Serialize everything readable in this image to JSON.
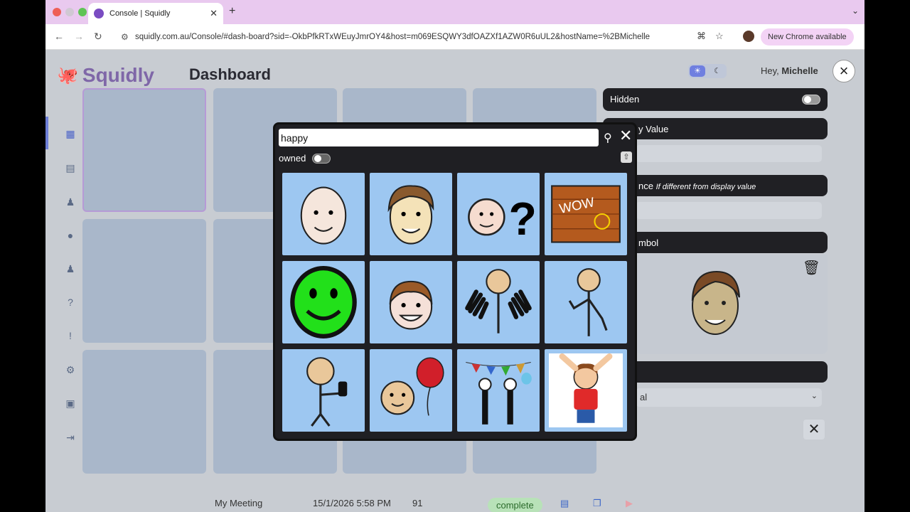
{
  "browser": {
    "tab_title": "Console | Squidly",
    "url": "squidly.com.au/Console/#dash-board?sid=-OkbPfkRTxWEuyJmrOY4&host=m069ESQWY3dfOAZXf1AZW0R6uUL2&hostName=%2BMichelle",
    "new_chrome": "New Chrome available"
  },
  "app": {
    "brand": "Squidly",
    "page_title": "Dashboard",
    "greeting": "Hey,",
    "user_name": "Michelle"
  },
  "right_panel": {
    "hidden_label": "Hidden",
    "value_label": "y Value",
    "pron_label": "nce",
    "pron_hint": "If different from display value",
    "symbol_label": "mbol",
    "select_value": "al"
  },
  "meeting": {
    "name": "My Meeting",
    "datetime": "15/1/2026 5:58 PM",
    "count": "91",
    "status": "complete"
  },
  "symbol_search": {
    "query": "happy",
    "owned_label": "owned",
    "results": [
      "bald-happy-face",
      "man-smiling-face",
      "face-question",
      "wow-brick-wall",
      "green-smiley",
      "boy-smiling-face",
      "waving-hands-person",
      "pointing-stick-figure",
      "thumbs-up-person",
      "balloon-person",
      "party-people",
      "cheering-child"
    ]
  },
  "colors": {
    "accent": "#7a4cc2",
    "modal": "#1f1f23",
    "tile": "#9dc7f1"
  }
}
